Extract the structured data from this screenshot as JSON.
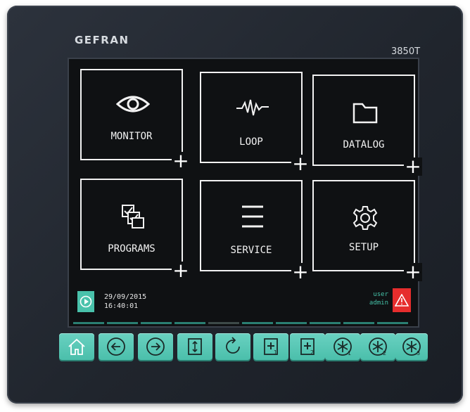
{
  "device": {
    "brand": "GEFRAN",
    "model": "3850T"
  },
  "menu": [
    {
      "label": "MONITOR",
      "icon": "eye-icon"
    },
    {
      "label": "LOOP",
      "icon": "waveform-icon"
    },
    {
      "label": "DATALOG",
      "icon": "folder-icon"
    },
    {
      "label": "PROGRAMS",
      "icon": "checklist-icon"
    },
    {
      "label": "SERVICE",
      "icon": "menu-lines-icon"
    },
    {
      "label": "SETUP",
      "icon": "gear-icon"
    }
  ],
  "tile_plus": "+",
  "status": {
    "date": "29/09/2015",
    "time": "16:40:01",
    "user_label": "user",
    "user_name": "admin"
  },
  "keys": [
    {
      "icon": "home-icon"
    },
    {
      "icon": "arrow-left-icon"
    },
    {
      "icon": "arrow-right-icon"
    },
    {
      "icon": "up-down-icon"
    },
    {
      "icon": "rotate-icon"
    },
    {
      "icon": "plus-1-icon",
      "sub": "1"
    },
    {
      "icon": "plus-2-icon",
      "sub": "2"
    },
    {
      "icon": "star-1-icon",
      "sub": "1"
    },
    {
      "icon": "star-2-icon",
      "sub": "2"
    },
    {
      "icon": "star-3-icon",
      "sub": "3"
    }
  ],
  "colors": {
    "accent": "#49c2ab",
    "alarm": "#e62d2d",
    "screen": "#0f1113",
    "bezel": "#23282f"
  }
}
